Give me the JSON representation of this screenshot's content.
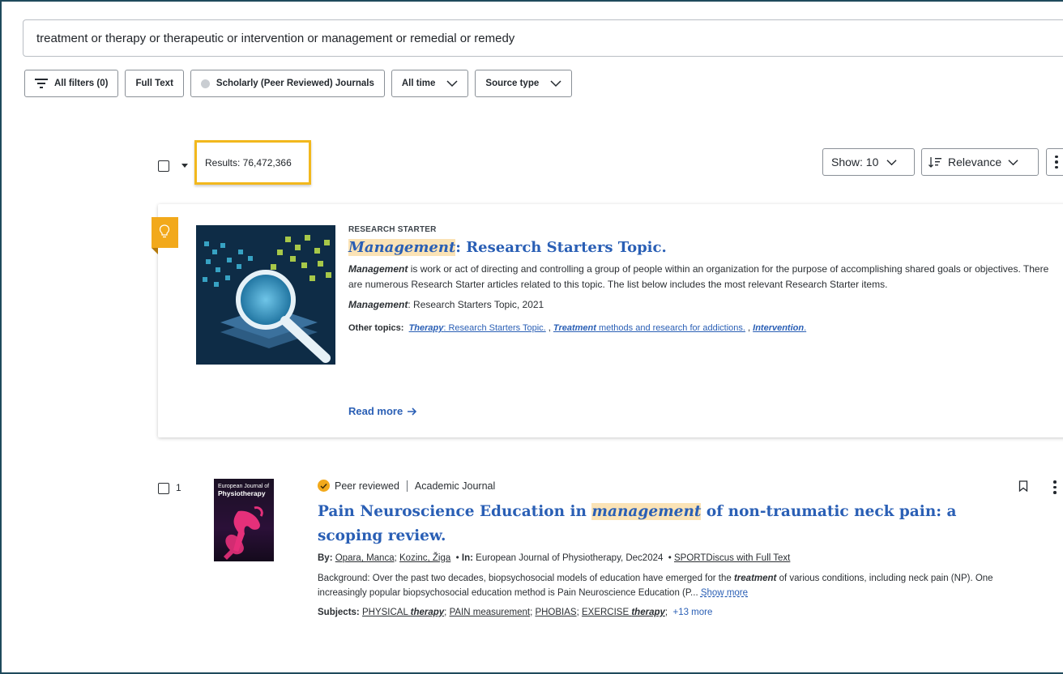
{
  "search": {
    "query": "treatment or therapy or therapeutic or intervention or management or remedial or remedy"
  },
  "filters": {
    "all_filters": "All filters (0)",
    "full_text": "Full Text",
    "scholarly": "Scholarly (Peer Reviewed) Journals",
    "all_time": "All time",
    "source_type": "Source type"
  },
  "results": {
    "count_label": "Results: 76,472,366",
    "show_label": "Show: 10",
    "sort_label": "Relevance"
  },
  "research_starter": {
    "kicker": "RESEARCH STARTER",
    "title_highlight": "Management",
    "title_rest": ": Research Starters Topic.",
    "desc_bold": "Management",
    "desc_rest": " is work or act of directing and controlling a group of people within an organization for the purpose of accomplishing shared goals or objectives. There are numerous Research Starter articles related to this topic. The list below includes the most relevant Research Starter items.",
    "source_bold": "Management",
    "source_rest": ": Research Starters Topic, 2021",
    "other_topics_label": "Other topics:",
    "topic1_bold": "Therapy",
    "topic1_rest": ": Research Starters Topic.",
    "topic2_bold": "Treatment",
    "topic2_rest": " methods and research for addictions.",
    "topic3_bold": "Intervention",
    "topic3_rest": ".",
    "sep": ",",
    "read_more": "Read more"
  },
  "item1": {
    "number": "1",
    "peer_reviewed": "Peer reviewed",
    "type": "Academic Journal",
    "cover_small": "European Journal of",
    "cover_big": "Physiotherapy",
    "title_a": "Pain Neuroscience Education in ",
    "title_hl": "management",
    "title_b": " of non-traumatic neck pain: a scoping review.",
    "by_label": "By:",
    "author1": "Opara, Manca",
    "author2": "Kozinc, Žiga",
    "in_label": "In:",
    "in_value": "European Journal of Physiotherapy, Dec2024",
    "database": "SPORTDiscus with Full Text",
    "abstract_a": "Background: Over the past two decades, biopsychosocial models of education have emerged for the ",
    "abstract_bold": "treatment",
    "abstract_b": " of various conditions, including neck pain (NP). One increasingly popular biopsychosocial education method is Pain Neuroscience Education (P...",
    "show_more": "Show more",
    "subjects_label": "Subjects:",
    "subj1_a": "PHYSICAL ",
    "subj1_b": "therapy",
    "subj2": "PAIN measurement",
    "subj3": "PHOBIAS",
    "subj4_a": "EXERCISE ",
    "subj4_b": "therapy",
    "subjects_more": "+13 more"
  },
  "colors": {
    "accent": "#2a5fb5",
    "highlight": "#fbe3b6",
    "flag": "#f2a91b",
    "focus": "#f2b81d"
  }
}
